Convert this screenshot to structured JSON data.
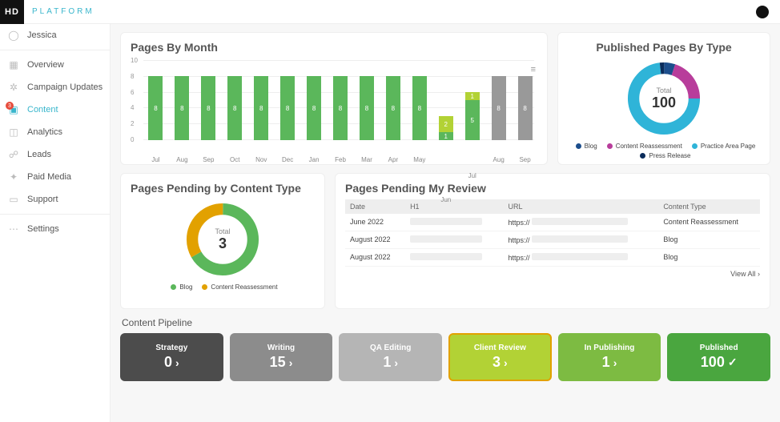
{
  "header": {
    "logo_mark": "HD",
    "logo_text": "PLATFORM"
  },
  "sidebar": {
    "items": [
      {
        "label": "Jessica",
        "icon": "◯",
        "active": false,
        "badge": null
      },
      {
        "label": "Overview",
        "icon": "▦",
        "active": false,
        "badge": null
      },
      {
        "label": "Campaign Updates",
        "icon": "✲",
        "active": false,
        "badge": null
      },
      {
        "label": "Content",
        "icon": "▣",
        "active": true,
        "badge": "3"
      },
      {
        "label": "Analytics",
        "icon": "◫",
        "active": false,
        "badge": null
      },
      {
        "label": "Leads",
        "icon": "☍",
        "active": false,
        "badge": null
      },
      {
        "label": "Paid Media",
        "icon": "✦",
        "active": false,
        "badge": null
      },
      {
        "label": "Support",
        "icon": "▭",
        "active": false,
        "badge": null
      }
    ],
    "settings": {
      "label": "Settings",
      "icon": "⋯"
    }
  },
  "chart_data": [
    {
      "id": "pages_by_month",
      "type": "bar",
      "title": "Pages By Month",
      "ylim": [
        0,
        10
      ],
      "yticks": [
        0,
        2,
        4,
        6,
        8,
        10
      ],
      "categories": [
        "Jul",
        "Aug",
        "Sep",
        "Oct",
        "Nov",
        "Dec",
        "Jan",
        "Feb",
        "Mar",
        "Apr",
        "May",
        "Jun",
        "Jul",
        "Aug",
        "Sep"
      ],
      "series": [
        {
          "name": "green",
          "color": "#5bb75b",
          "values": [
            8,
            8,
            8,
            8,
            8,
            8,
            8,
            8,
            8,
            8,
            8,
            1,
            5,
            0,
            0
          ]
        },
        {
          "name": "lime",
          "color": "#b2d235",
          "values": [
            0,
            0,
            0,
            0,
            0,
            0,
            0,
            0,
            0,
            0,
            0,
            2,
            1,
            0,
            0
          ]
        },
        {
          "name": "gray",
          "color": "#999",
          "values": [
            0,
            0,
            0,
            0,
            0,
            0,
            0,
            0,
            0,
            0,
            0,
            0,
            0,
            8,
            8
          ]
        }
      ]
    },
    {
      "id": "published_by_type",
      "type": "pie",
      "title": "Published Pages By Type",
      "total_label": "Total",
      "total_value": "100",
      "series": [
        {
          "name": "Blog",
          "color": "#1c4e8c",
          "value": 5
        },
        {
          "name": "Content Reassessment",
          "color": "#b83d9b",
          "value": 20
        },
        {
          "name": "Practice Area Page",
          "color": "#2fb4d8",
          "value": 73
        },
        {
          "name": "Press Release",
          "color": "#0a2c5b",
          "value": 2
        }
      ]
    },
    {
      "id": "pending_by_type",
      "type": "pie",
      "title": "Pages Pending by Content Type",
      "total_label": "Total",
      "total_value": "3",
      "series": [
        {
          "name": "Blog",
          "color": "#5bb75b",
          "value": 2
        },
        {
          "name": "Content Reassessment",
          "color": "#e2a100",
          "value": 1
        }
      ]
    }
  ],
  "pending_review": {
    "title": "Pages Pending My Review",
    "columns": [
      "Date",
      "H1",
      "URL",
      "Content Type"
    ],
    "rows": [
      {
        "date": "June 2022",
        "url_prefix": "https://",
        "type": "Content Reassessment"
      },
      {
        "date": "August 2022",
        "url_prefix": "https://",
        "type": "Blog"
      },
      {
        "date": "August 2022",
        "url_prefix": "https://",
        "type": "Blog"
      }
    ],
    "view_all": "View All  ›"
  },
  "pipeline": {
    "title": "Content Pipeline",
    "stages": [
      {
        "label": "Strategy",
        "value": "0",
        "color": "#4c4c4c",
        "icon": "›"
      },
      {
        "label": "Writing",
        "value": "15",
        "color": "#8c8c8c",
        "icon": "›"
      },
      {
        "label": "QA Editing",
        "value": "1",
        "color": "#b5b5b5",
        "icon": "›"
      },
      {
        "label": "Client Review",
        "value": "3",
        "color": "#b2d235",
        "border": "#e2a100",
        "icon": "›"
      },
      {
        "label": "In Publishing",
        "value": "1",
        "color": "#7dbb42",
        "icon": "›"
      },
      {
        "label": "Published",
        "value": "100",
        "color": "#4aa63f",
        "icon": "✓"
      }
    ]
  }
}
